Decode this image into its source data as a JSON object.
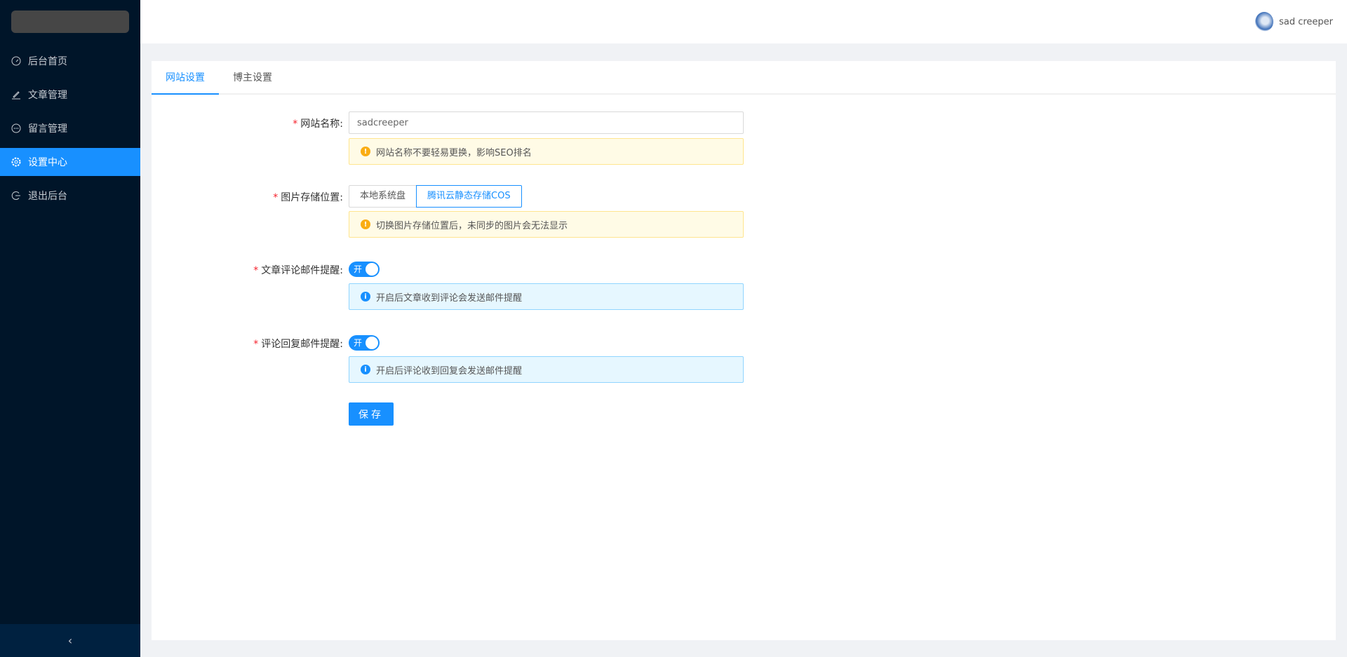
{
  "sidebar": {
    "items": [
      {
        "label": "后台首页",
        "icon": "dashboard-icon"
      },
      {
        "label": "文章管理",
        "icon": "edit-icon"
      },
      {
        "label": "留言管理",
        "icon": "message-icon"
      },
      {
        "label": "设置中心",
        "icon": "setting-icon",
        "active": true
      },
      {
        "label": "退出后台",
        "icon": "logout-icon"
      }
    ],
    "collapse_glyph": "‹"
  },
  "header": {
    "username": "sad creeper"
  },
  "tabs": [
    "网站设置",
    "博主设置"
  ],
  "form": {
    "site_name": {
      "label": "网站名称:",
      "value": "sadcreeper",
      "tip": "网站名称不要轻易更换，影响SEO排名"
    },
    "storage": {
      "label": "图片存储位置:",
      "options": [
        "本地系统盘",
        "腾讯云静态存储COS"
      ],
      "selected": "腾讯云静态存储COS",
      "tip": "切换图片存储位置后，未同步的图片会无法显示"
    },
    "comment_mail": {
      "label": "文章评论邮件提醒:",
      "switch_text": "开",
      "on": true,
      "tip": "开启后文章收到评论会发送邮件提醒"
    },
    "reply_mail": {
      "label": "评论回复邮件提醒:",
      "switch_text": "开",
      "on": true,
      "tip": "开启后评论收到回复会发送邮件提醒"
    },
    "save_label": "保存",
    "required_mark": "*"
  },
  "colors": {
    "primary": "#1890ff",
    "sidebar": "#001529"
  }
}
